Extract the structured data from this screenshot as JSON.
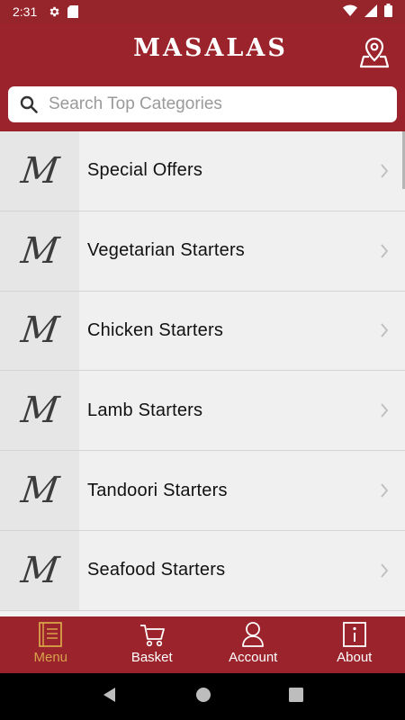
{
  "status_bar": {
    "time": "2:31"
  },
  "header": {
    "title": "MASALAS"
  },
  "search": {
    "placeholder": "Search Top Categories",
    "value": ""
  },
  "categories": [
    {
      "label": "Special Offers",
      "logo": "M"
    },
    {
      "label": "Vegetarian Starters",
      "logo": "M"
    },
    {
      "label": "Chicken Starters",
      "logo": "M"
    },
    {
      "label": "Lamb Starters",
      "logo": "M"
    },
    {
      "label": "Tandoori Starters",
      "logo": "M"
    },
    {
      "label": "Seafood Starters",
      "logo": "M"
    }
  ],
  "tabs": [
    {
      "label": "Menu",
      "icon": "menu-book-icon",
      "active": true
    },
    {
      "label": "Basket",
      "icon": "cart-icon",
      "active": false
    },
    {
      "label": "Account",
      "icon": "person-icon",
      "active": false
    },
    {
      "label": "About",
      "icon": "info-icon",
      "active": false
    }
  ],
  "colors": {
    "brand": "#9b242c",
    "active_tab": "#d8a24a"
  }
}
